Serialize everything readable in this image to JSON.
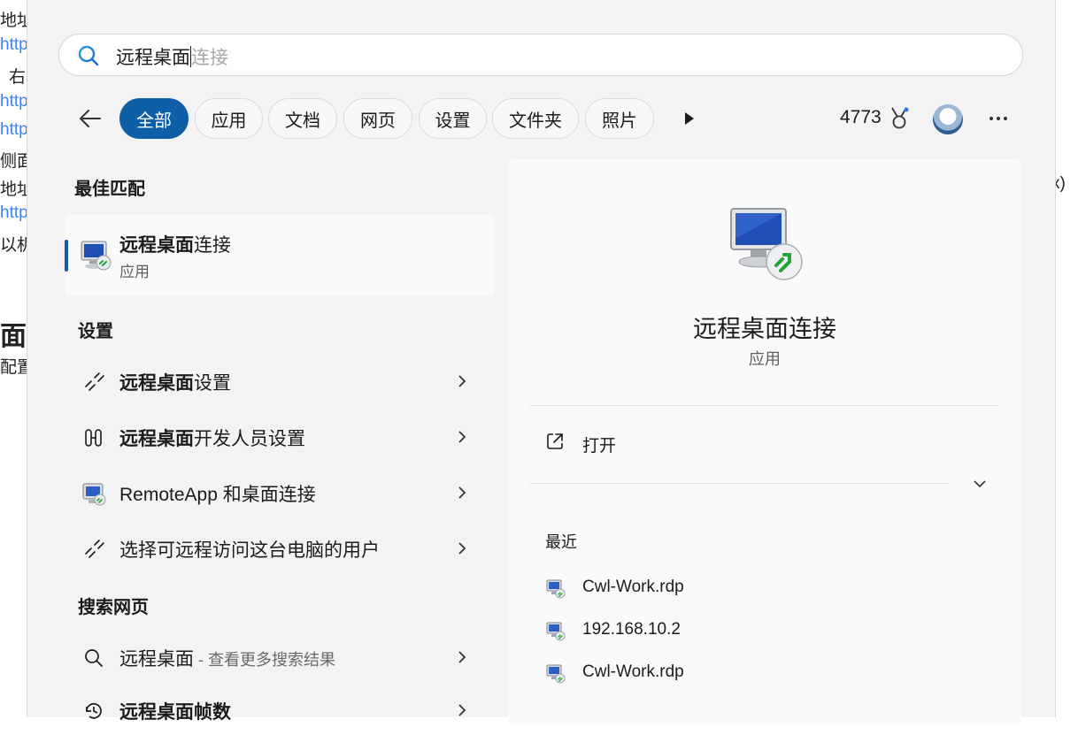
{
  "background_doc": {
    "lines_left": [
      "地址",
      "http",
      "右",
      "http",
      "http",
      "侧面",
      "地址",
      "http",
      "以机",
      "面边",
      "配置"
    ],
    "right_fragment": "x)"
  },
  "search": {
    "typed": "远程桌面",
    "suggestion": "连接"
  },
  "filters": [
    "全部",
    "应用",
    "文档",
    "网页",
    "设置",
    "文件夹",
    "照片"
  ],
  "header": {
    "points": "4773"
  },
  "sections": {
    "best_match": "最佳匹配",
    "settings": "设置",
    "web": "搜索网页"
  },
  "best_match": {
    "title_bold": "远程桌面",
    "title_rest": "连接",
    "subtitle": "应用"
  },
  "settings_results": [
    {
      "bold": "远程桌面",
      "rest": "设置"
    },
    {
      "bold": "远程桌面",
      "rest": "开发人员设置"
    },
    {
      "bold": "",
      "rest": "RemoteApp 和桌面连接"
    },
    {
      "bold": "",
      "rest": "选择可远程访问这台电脑的用户"
    }
  ],
  "web_results": [
    {
      "bold": "",
      "rest": "远程桌面",
      "hint": " - 查看更多搜索结果"
    },
    {
      "bold": "远程桌面帧数",
      "rest": "",
      "hint": ""
    }
  ],
  "preview": {
    "title": "远程桌面连接",
    "subtitle": "应用",
    "open_label": "打开",
    "recent_title": "最近",
    "recent": [
      "Cwl-Work.rdp",
      "192.168.10.2",
      "Cwl-Work.rdp"
    ]
  },
  "colors": {
    "accent": "#0e5fa8",
    "panel_bg": "#f3f3f3",
    "rdp_green": "#22a33a"
  }
}
